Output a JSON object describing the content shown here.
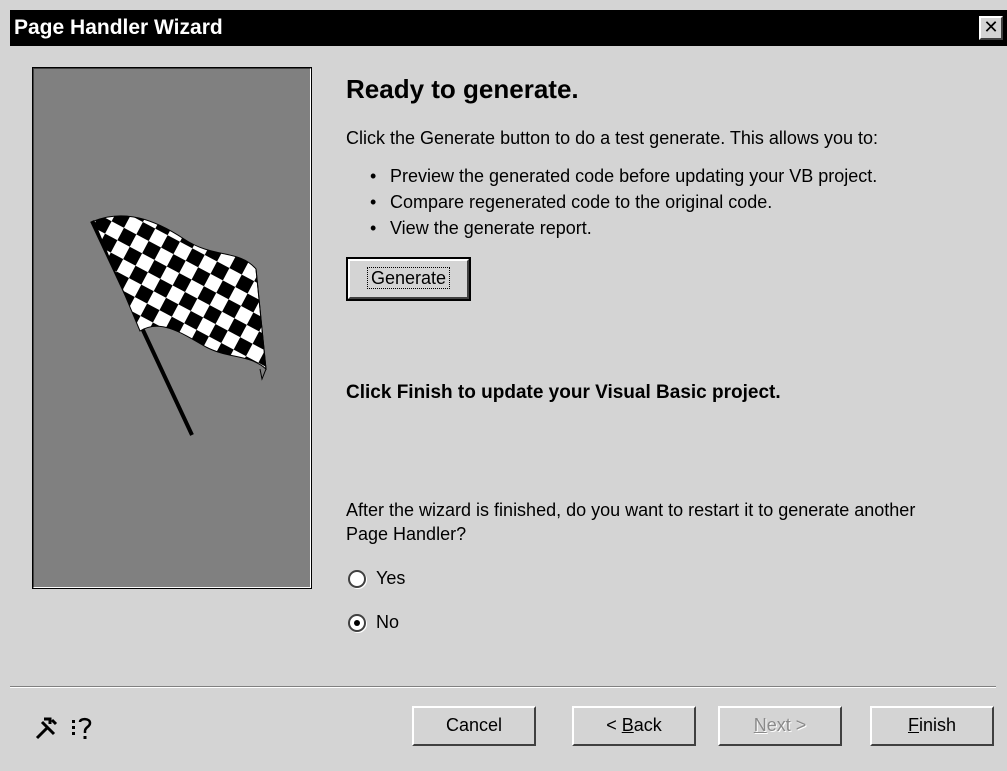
{
  "window": {
    "title": "Page Handler Wizard",
    "close_glyph": "✕"
  },
  "main": {
    "heading": "Ready to generate.",
    "intro": "Click the Generate button to do a test generate. This allows you to:",
    "bullets": [
      "Preview the generated code before updating your VB project.",
      "Compare regenerated code to the original code.",
      "View the generate report."
    ],
    "generate_button": "Generate",
    "finish_note": "Click Finish to update your Visual Basic project.",
    "restart_question": "After the wizard is finished, do you want to restart it to generate another Page Handler?",
    "restart_options": [
      {
        "label": "Yes",
        "checked": false
      },
      {
        "label": "No",
        "checked": true
      }
    ]
  },
  "footer": {
    "icons": [
      "tools-icon",
      "help-topic-icon"
    ],
    "cancel": "Cancel",
    "back": {
      "prefix": "< ",
      "accel": "B",
      "rest": "ack"
    },
    "next": {
      "accel": "N",
      "rest": "ext >"
    },
    "finish": {
      "accel": "F",
      "rest": "inish"
    }
  }
}
